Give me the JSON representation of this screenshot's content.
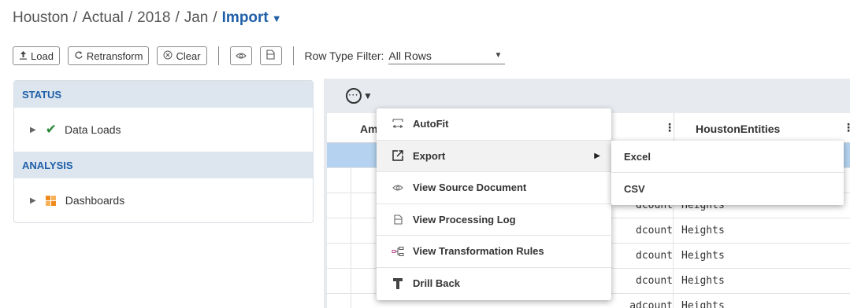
{
  "breadcrumb": {
    "parts": [
      "Houston",
      "Actual",
      "2018",
      "Jan"
    ],
    "separator": "/",
    "current": "Import",
    "caret": "▼"
  },
  "toolbar": {
    "load_label": "Load",
    "retransform_label": "Retransform",
    "clear_label": "Clear",
    "row_type_filter_label": "Row Type Filter:",
    "row_type_filter_value": "All Rows"
  },
  "left_panel": {
    "status_heading": "STATUS",
    "data_loads_label": "Data Loads",
    "analysis_heading": "ANALYSIS",
    "dashboards_label": "Dashboards"
  },
  "grid": {
    "col_amount_partial": "Am",
    "col_entities": "HoustonEntities",
    "rows": [
      {
        "left": "",
        "right": ""
      },
      {
        "left": "",
        "right": ""
      },
      {
        "left": "dcount",
        "right": "Heights"
      },
      {
        "left": "dcount",
        "right": "Heights"
      },
      {
        "left": "dcount",
        "right": "Heights"
      },
      {
        "left": "dcount",
        "right": "Heights"
      },
      {
        "left": "adcount",
        "right": "Heights"
      }
    ]
  },
  "context_menu": {
    "items": [
      {
        "label": "AutoFit",
        "icon": "autofit-icon"
      },
      {
        "label": "Export",
        "icon": "export-icon"
      },
      {
        "label": "View Source Document",
        "icon": "eye-icon"
      },
      {
        "label": "View Processing Log",
        "icon": "document-icon"
      },
      {
        "label": "View Transformation Rules",
        "icon": "transformation-rules-icon"
      },
      {
        "label": "Drill Back",
        "icon": "drill-icon"
      }
    ],
    "export_submenu": [
      "Excel",
      "CSV"
    ]
  },
  "colors": {
    "accent": "#1f5fa8",
    "section_header_bg": "#dde6ef",
    "selected_row": "#b5d3f0",
    "success": "#2a8a3a",
    "dashboard_orange": "#f08a1c",
    "rules_pink": "#c04f9a"
  }
}
